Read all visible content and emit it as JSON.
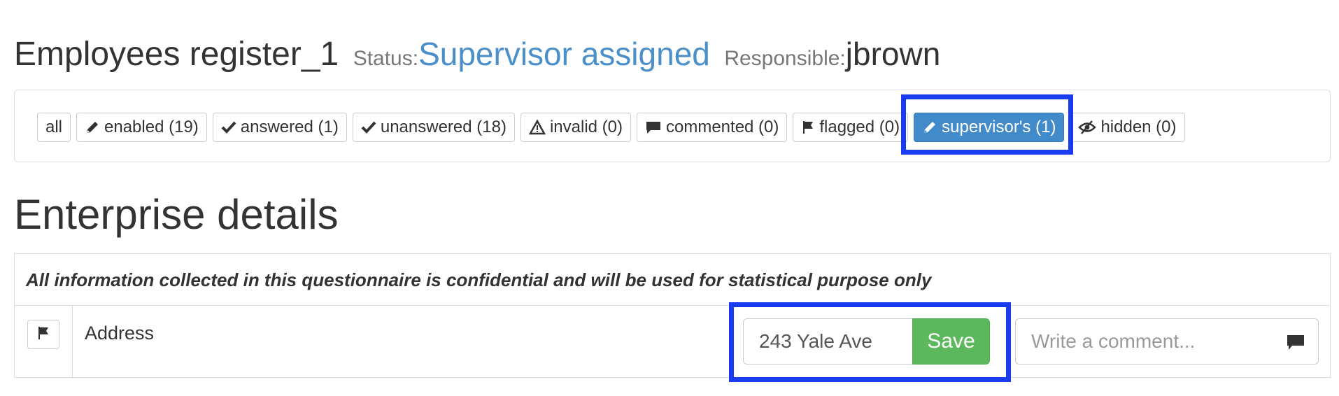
{
  "header": {
    "title": "Employees register_1",
    "status_label": "Status:",
    "status_value": "Supervisor assigned",
    "responsible_label": "Responsible:",
    "responsible_value": "jbrown"
  },
  "filters": {
    "all": "all",
    "enabled": "enabled (19)",
    "answered": "answered (1)",
    "unanswered": "unanswered (18)",
    "invalid": "invalid (0)",
    "commented": "commented (0)",
    "flagged": "flagged (0)",
    "supervisors": "supervisor's (1)",
    "hidden": "hidden (0)",
    "active": "supervisors"
  },
  "section": {
    "title": "Enterprise details",
    "note": "All information collected in this questionnaire is confidential and will be used for statistical purpose only"
  },
  "question": {
    "label": "Address",
    "answer_value": "243 Yale Ave",
    "save_label": "Save",
    "comment_placeholder": "Write a comment..."
  },
  "colors": {
    "status": "#4a8fc9",
    "active_filter": "#428bca",
    "save": "#5cb85c",
    "highlight": "#1a3cf0"
  },
  "icons": {
    "enabled": "pencil-icon",
    "answered": "checkmark-icon",
    "unanswered": "checkmark-icon",
    "invalid": "warning-icon",
    "commented": "comment-icon",
    "flagged": "flag-icon",
    "supervisors": "pencil-icon",
    "hidden": "eye-slash-icon",
    "question_flag": "flag-icon",
    "comment_send": "comment-icon"
  }
}
